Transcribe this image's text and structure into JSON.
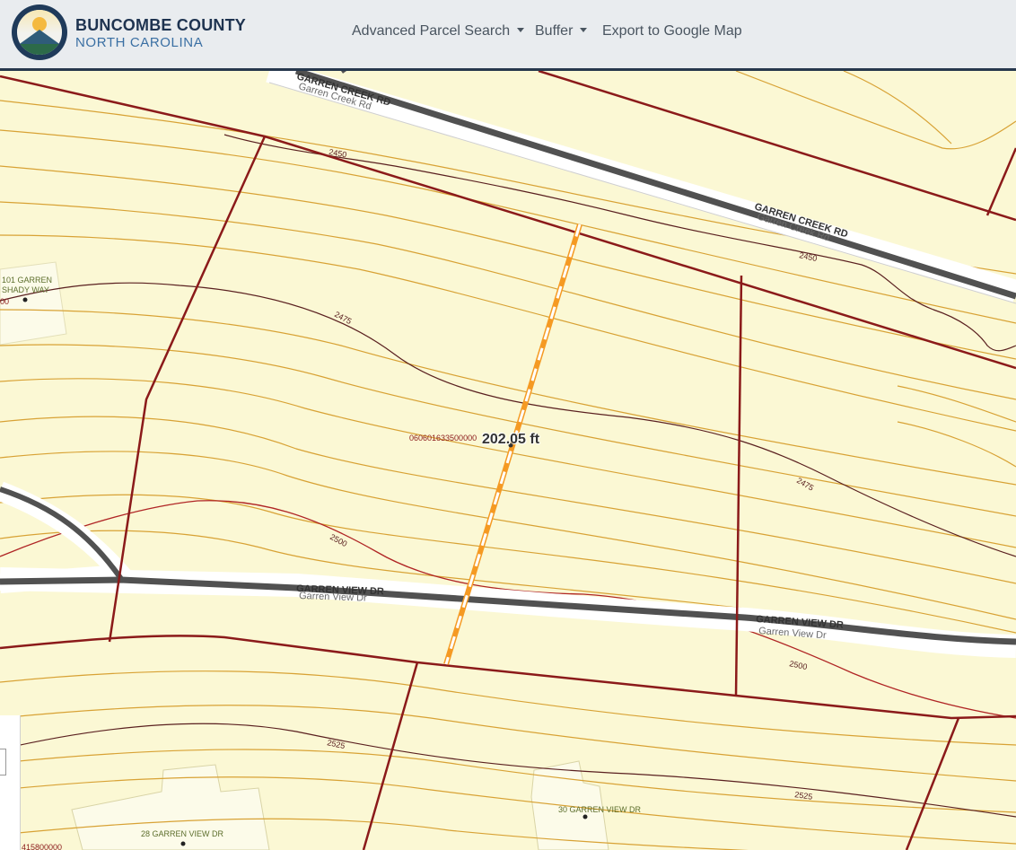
{
  "header": {
    "brand_title": "BUNCOMBE COUNTY",
    "brand_subtitle": "NORTH CAROLINA",
    "nav": [
      {
        "label": "Advanced Parcel Search",
        "has_dropdown": true
      },
      {
        "label": "Buffer",
        "has_dropdown": true
      },
      {
        "label": "Export to Google Map",
        "has_dropdown": false
      }
    ]
  },
  "map": {
    "measurement": "202.05 ft",
    "parcel_id": "060601633500000",
    "road_labels": {
      "garren_creek_upper": "GARREN CREEK RD",
      "garren_creek_upper_sub": "Garren Creek Rd",
      "garren_creek_right": "GARREN CREEK RD",
      "garren_creek_right_sub": "Garren Creek Rd",
      "garren_view_mid": "GARREN VIEW DR",
      "garren_view_mid_sub": "Garren View Dr",
      "garren_view_right": "GARREN VIEW DR",
      "garren_view_right_sub": "Garren View Dr"
    },
    "contours": {
      "c1": "2450",
      "c2": "2450",
      "c3": "2475",
      "c4": "2475",
      "c5": "2500",
      "c6": "2500",
      "c7": "2525",
      "c8": "2525"
    },
    "addresses": {
      "shady_way_1": "101 GARREN",
      "shady_way_2": "SHADY WAY",
      "shady_way_pin": "00",
      "view_28": "28 GARREN VIEW DR",
      "view_30": "30 GARREN VIEW DR",
      "bottom_pin": "415800000"
    },
    "colors": {
      "parcel_line": "#8b1a1a",
      "contour_minor": "#d8a235",
      "contour_major": "#5a2020",
      "road": "#505050",
      "measure": "#f59a23",
      "background": "#fbf8d4"
    }
  }
}
